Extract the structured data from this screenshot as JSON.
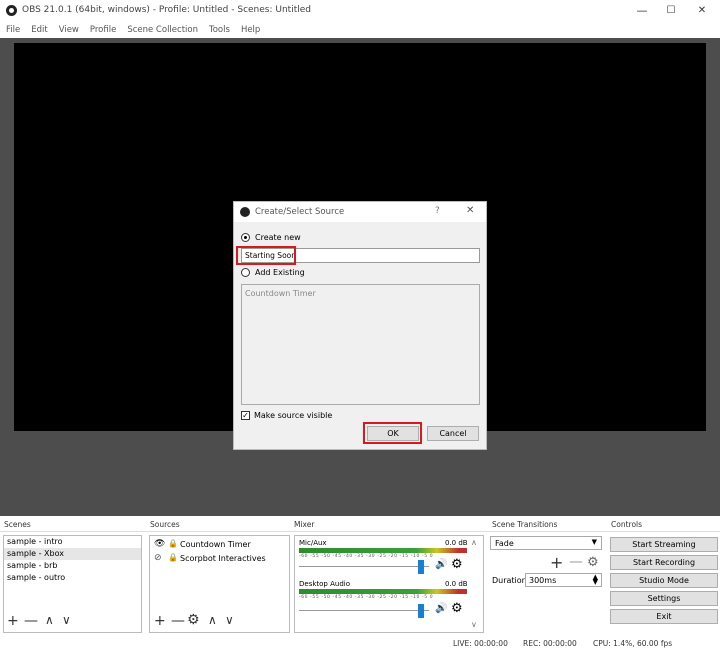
{
  "window": {
    "title": "OBS 21.0.1 (64bit, windows) - Profile: Untitled - Scenes: Untitled",
    "min": "—",
    "max": "☐",
    "close": "✕"
  },
  "menu": [
    "File",
    "Edit",
    "View",
    "Profile",
    "Scene Collection",
    "Tools",
    "Help"
  ],
  "dialog": {
    "title": "Create/Select Source",
    "help": "?",
    "close": "✕",
    "create_new": "Create new",
    "name_value": "Starting Soon",
    "add_existing": "Add Existing",
    "existing_items": [
      "Countdown Timer"
    ],
    "make_visible": "Make source visible",
    "ok": "OK",
    "cancel": "Cancel"
  },
  "docks": {
    "scenes": {
      "title": "Scenes",
      "items": [
        "sample - intro",
        "sample - Xbox",
        "sample - brb",
        "sample - outro"
      ],
      "selected": 1
    },
    "sources": {
      "title": "Sources",
      "items": [
        {
          "label": "Countdown Timer"
        },
        {
          "label": "Scorpbot Interactives"
        }
      ]
    },
    "mixer": {
      "title": "Mixer",
      "channels": [
        {
          "name": "Mic/Aux",
          "db": "0.0 dB",
          "level": 0.94
        },
        {
          "name": "Desktop Audio",
          "db": "0.0 dB",
          "level": 0.94
        }
      ],
      "scale": "-60 -55 -50 -45 -40 -35 -30 -25 -20 -15 -10 -5 0"
    },
    "transitions": {
      "title": "Scene Transitions",
      "type": "Fade",
      "duration_label": "Duration",
      "duration": "300ms"
    },
    "controls": {
      "title": "Controls",
      "buttons": [
        "Start Streaming",
        "Start Recording",
        "Studio Mode",
        "Settings",
        "Exit"
      ]
    }
  },
  "status": {
    "live": "LIVE: 00:00:00",
    "rec": "REC: 00:00:00",
    "cpu": "CPU: 1.4%, 60.00 fps"
  },
  "colors": {
    "highlight": "#d71920",
    "preview_bg": "#4d4d4d",
    "canvas": "#000000",
    "volume_thumb": "#1a7fd1"
  },
  "icons": [
    "obs-icon",
    "eye-icon",
    "eye-hidden-icon",
    "lock-icon",
    "plus-icon",
    "minus-icon",
    "gear-icon",
    "chevron-up-icon",
    "chevron-down-icon",
    "speaker-icon"
  ]
}
